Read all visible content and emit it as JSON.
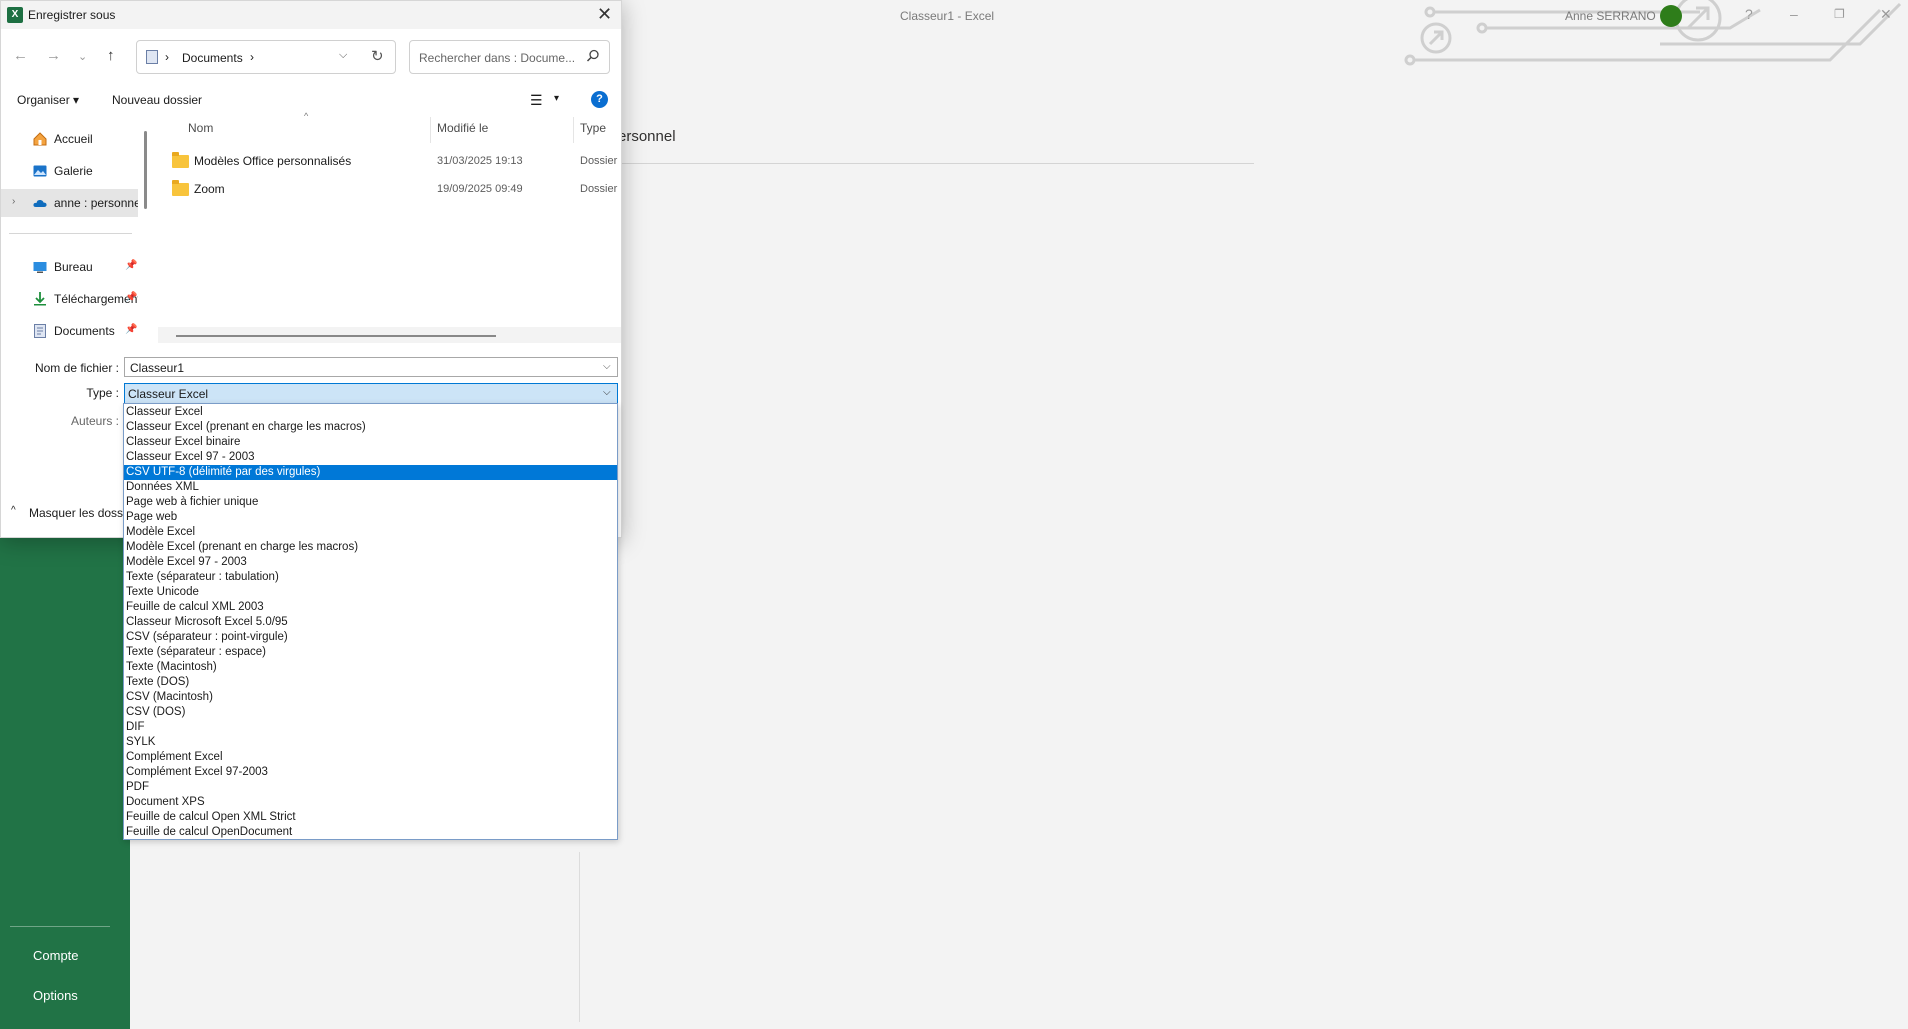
{
  "excel": {
    "title": "Classeur1  -  Excel",
    "user_name": "Anne SERRANO",
    "section_title": "ersonnel",
    "nav": [
      "Compte",
      "Options"
    ]
  },
  "dialog": {
    "title": "Enregistrer sous",
    "address": {
      "crumb": "Documents"
    },
    "search_placeholder": "Rechercher dans : Docume...",
    "toolbar": {
      "organize": "Organiser",
      "new_folder": "Nouveau dossier"
    },
    "sidebar": [
      {
        "label": "Accueil",
        "icon": "home-icon"
      },
      {
        "label": "Galerie",
        "icon": "gallery-icon"
      },
      {
        "label": "anne : personnel",
        "icon": "onedrive-icon"
      },
      {
        "label": "Bureau",
        "icon": "desktop-icon"
      },
      {
        "label": "Téléchargements",
        "icon": "download-icon"
      },
      {
        "label": "Documents",
        "icon": "documents-icon"
      }
    ],
    "columns": [
      "Nom",
      "Modifié le",
      "Type"
    ],
    "files": [
      {
        "name": "Modèles Office personnalisés",
        "modified": "31/03/2025 19:13",
        "type": "Dossier"
      },
      {
        "name": "Zoom",
        "modified": "19/09/2025 09:49",
        "type": "Dossier"
      }
    ],
    "form": {
      "filename_label": "Nom de fichier :",
      "filename_value": "Classeur1",
      "type_label": "Type :",
      "type_value": "Classeur Excel",
      "authors_label": "Auteurs :"
    },
    "hide_folders": "Masquer les dossiers",
    "type_options": [
      "Classeur Excel",
      "Classeur Excel (prenant en charge les macros)",
      "Classeur Excel binaire",
      "Classeur Excel 97 - 2003",
      "CSV UTF-8 (délimité par des virgules)",
      "Données XML",
      "Page web à fichier unique",
      "Page web",
      "Modèle Excel",
      "Modèle Excel (prenant en charge les macros)",
      "Modèle Excel 97 - 2003",
      "Texte (séparateur : tabulation)",
      "Texte Unicode",
      "Feuille de calcul XML 2003",
      "Classeur Microsoft Excel 5.0/95",
      "CSV (séparateur : point-virgule)",
      "Texte (séparateur : espace)",
      "Texte (Macintosh)",
      "Texte (DOS)",
      "CSV (Macintosh)",
      "CSV (DOS)",
      "DIF",
      "SYLK",
      "Complément Excel",
      "Complément Excel 97-2003",
      "PDF",
      "Document XPS",
      "Feuille de calcul Open XML Strict",
      "Feuille de calcul OpenDocument"
    ],
    "highlighted_option": "CSV UTF-8 (délimité par des virgules)"
  },
  "colors": {
    "excel_green": "#217346",
    "highlight": "#0078d7",
    "accent": "#0078d4"
  }
}
